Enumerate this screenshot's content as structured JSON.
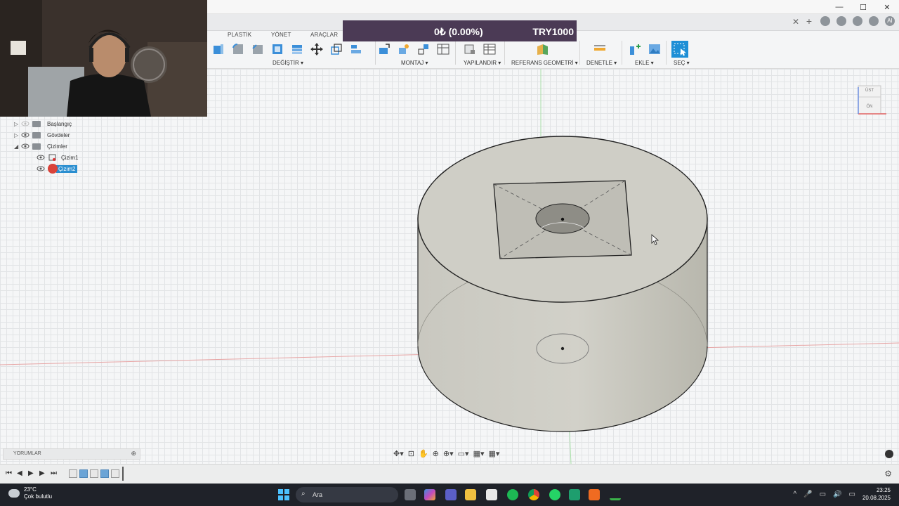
{
  "window": {
    "minimize": "—",
    "maximize": "☐",
    "close": "✕"
  },
  "tabstrip": {
    "close_tab": "✕",
    "new_tab": "+",
    "user": "AI"
  },
  "toolbar": {
    "tab_titles": [
      "PLASTİK",
      "YÖNET",
      "ARAÇLAR"
    ],
    "groups": [
      "DEĞİŞTİR ▾",
      "MONTAJ ▾",
      "YAPILANDIR ▾",
      "REFERANS GEOMETRİ ▾",
      "DENETLE ▾",
      "EKLE ▾",
      "SEÇ ▾"
    ]
  },
  "banner": {
    "pct": "0₺ (0.00%)",
    "target": "TRY1000"
  },
  "browser": {
    "items": [
      {
        "label": "Başlangıç",
        "expanded": false
      },
      {
        "label": "Gövdeler",
        "expanded": false
      },
      {
        "label": "Çizimler",
        "expanded": true
      },
      {
        "label": "Çizim1"
      },
      {
        "label": "Çizim2",
        "selected": true
      }
    ]
  },
  "viewcube": {
    "top": "ÜST",
    "front": "ÖN"
  },
  "comments": {
    "label": "YORUMLAR",
    "add": "⊕"
  },
  "navbar": [
    "✥▾",
    "⊡",
    "✋",
    "⊕",
    "⊕▾",
    "▭▾",
    "▦▾",
    "▦▾"
  ],
  "timeline": {
    "first": "⏮",
    "prev": "◀",
    "play": "▶",
    "next": "▶",
    "last": "⏭",
    "settings": "⚙"
  },
  "taskbar": {
    "temp": "23°C",
    "weather": "Çok bulutlu",
    "search": "Ara",
    "time": "23:25",
    "date": "20.08.2025",
    "tray": [
      "^",
      "🎤",
      "▭",
      "🔊",
      "▭"
    ]
  },
  "colors": {
    "selection": "#2a8ed0",
    "banner": "#4b3a55",
    "accent": "#0696d7"
  }
}
